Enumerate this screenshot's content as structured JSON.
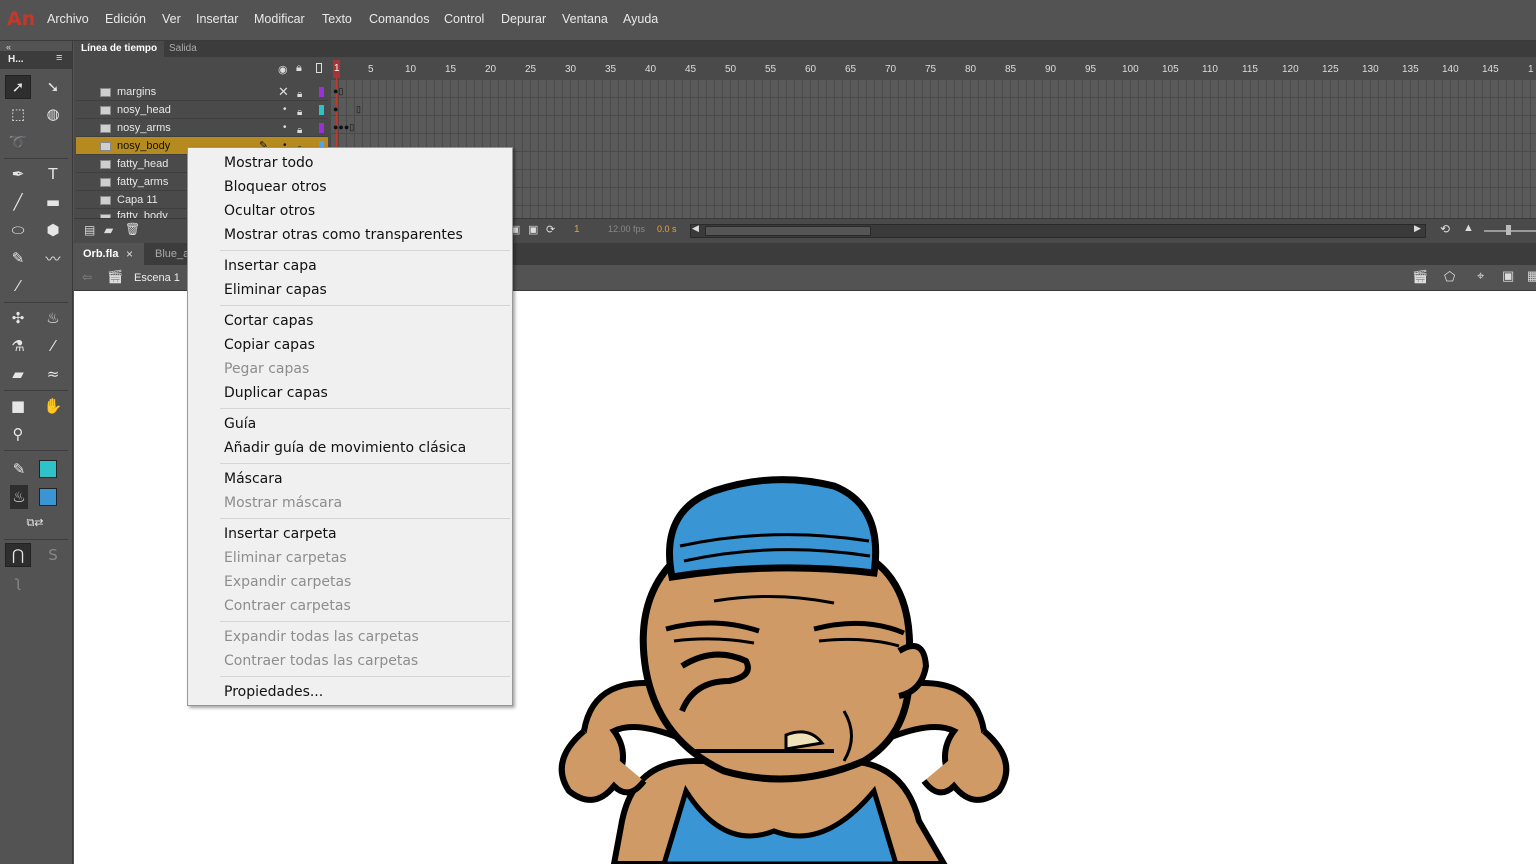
{
  "app": {
    "logo": "An"
  },
  "menubar": {
    "items": [
      "Archivo",
      "Edición",
      "Ver",
      "Insertar",
      "Modificar",
      "Texto",
      "Comandos",
      "Control",
      "Depurar",
      "Ventana",
      "Ayuda"
    ]
  },
  "toolbar": {
    "header": "H...",
    "tools": [
      "selection-icon",
      "subselection-icon",
      "free-transform-icon",
      "3d-rotation-icon",
      "lasso-icon",
      "pen-icon",
      "text-icon",
      "line-icon",
      "rectangle-icon",
      "oval-icon",
      "polystar-icon",
      "pencil-icon",
      "brush-icon",
      "paint-brush-icon",
      "bone-icon",
      "paint-bucket-icon",
      "ink-bottle-icon",
      "eyedropper-icon",
      "eraser-icon",
      "width-icon",
      "camera-icon",
      "hand-icon",
      "zoom-icon"
    ],
    "stroke_color": "#2fc3c9",
    "fill_color": "#3a95d4"
  },
  "timeline": {
    "tabs": [
      "Línea de tiempo",
      "Salida"
    ],
    "ruler_ticks": [
      "1",
      "5",
      "10",
      "15",
      "20",
      "25",
      "30",
      "35",
      "40",
      "45",
      "50",
      "55",
      "60",
      "65",
      "70",
      "75",
      "80",
      "85",
      "90",
      "95",
      "100",
      "105",
      "110",
      "115",
      "120",
      "125",
      "130",
      "135",
      "140",
      "145",
      "1"
    ],
    "layers": [
      {
        "name": "margins",
        "color": "#9b30d9",
        "active": false
      },
      {
        "name": "nosy_head",
        "color": "#2fc3c9",
        "active": false
      },
      {
        "name": "nosy_arms",
        "color": "#9b30d9",
        "active": false
      },
      {
        "name": "nosy_body",
        "color": "#4aa3ff",
        "active": true
      },
      {
        "name": "fatty_head",
        "color": "#2fc3c9",
        "active": false
      },
      {
        "name": "fatty_arms",
        "color": "#9b30d9",
        "active": false
      },
      {
        "name": "Capa 11",
        "color": "#4aa3ff",
        "active": false
      },
      {
        "name": "fatty_body",
        "color": "#9b30d9",
        "active": false
      }
    ],
    "footer": {
      "frame": "1",
      "fps": "12.00 fps",
      "time": "0.0 s"
    }
  },
  "documents": {
    "tabs": [
      "Orb.fla",
      "Blue_a"
    ],
    "close_icon": "×"
  },
  "editbar": {
    "scene": "Escena 1"
  },
  "context_menu": {
    "groups": [
      [
        {
          "label": "Mostrar todo",
          "enabled": true
        },
        {
          "label": "Bloquear otros",
          "enabled": true
        },
        {
          "label": "Ocultar otros",
          "enabled": true
        },
        {
          "label": "Mostrar otras como transparentes",
          "enabled": true
        }
      ],
      [
        {
          "label": "Insertar capa",
          "enabled": true
        },
        {
          "label": "Eliminar capas",
          "enabled": true
        }
      ],
      [
        {
          "label": "Cortar capas",
          "enabled": true
        },
        {
          "label": "Copiar capas",
          "enabled": true
        },
        {
          "label": "Pegar capas",
          "enabled": false
        },
        {
          "label": "Duplicar capas",
          "enabled": true
        }
      ],
      [
        {
          "label": "Guía",
          "enabled": true
        },
        {
          "label": "Añadir guía de movimiento clásica",
          "enabled": true
        }
      ],
      [
        {
          "label": "Máscara",
          "enabled": true
        },
        {
          "label": "Mostrar máscara",
          "enabled": false
        }
      ],
      [
        {
          "label": "Insertar carpeta",
          "enabled": true
        },
        {
          "label": "Eliminar carpetas",
          "enabled": false
        },
        {
          "label": "Expandir carpetas",
          "enabled": false
        },
        {
          "label": "Contraer carpetas",
          "enabled": false
        }
      ],
      [
        {
          "label": "Expandir todas las carpetas",
          "enabled": false
        },
        {
          "label": "Contraer todas las carpetas",
          "enabled": false
        }
      ],
      [
        {
          "label": "Propiedades...",
          "enabled": true
        }
      ]
    ]
  }
}
